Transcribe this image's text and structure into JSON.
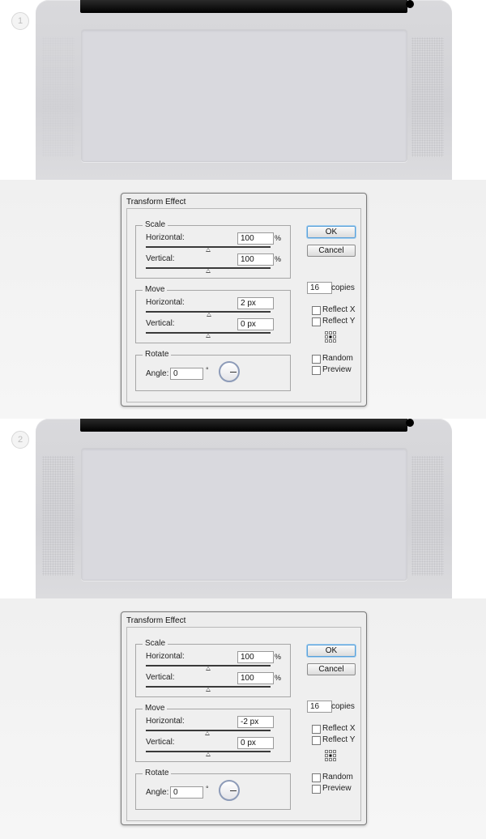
{
  "steps": [
    "1",
    "2"
  ],
  "dialogs": [
    {
      "title": "Transform Effect",
      "scale": {
        "label": "Scale",
        "horizontal_label": "Horizontal:",
        "horizontal_value": "100",
        "horizontal_unit": "%",
        "vertical_label": "Vertical:",
        "vertical_value": "100",
        "vertical_unit": "%"
      },
      "move": {
        "label": "Move",
        "horizontal_label": "Horizontal:",
        "horizontal_value": "2 px",
        "vertical_label": "Vertical:",
        "vertical_value": "0 px"
      },
      "rotate": {
        "label": "Rotate",
        "angle_label": "Angle:",
        "angle_value": "0",
        "degree_symbol": "°"
      },
      "ok_label": "OK",
      "cancel_label": "Cancel",
      "copies_value": "16",
      "copies_label": "copies",
      "reflect_x": "Reflect X",
      "reflect_y": "Reflect Y",
      "random": "Random",
      "preview": "Preview"
    },
    {
      "title": "Transform Effect",
      "scale": {
        "label": "Scale",
        "horizontal_label": "Horizontal:",
        "horizontal_value": "100",
        "horizontal_unit": "%",
        "vertical_label": "Vertical:",
        "vertical_value": "100",
        "vertical_unit": "%"
      },
      "move": {
        "label": "Move",
        "horizontal_label": "Horizontal:",
        "horizontal_value": "-2 px",
        "vertical_label": "Vertical:",
        "vertical_value": "0 px"
      },
      "rotate": {
        "label": "Rotate",
        "angle_label": "Angle:",
        "angle_value": "0",
        "degree_symbol": "°"
      },
      "ok_label": "OK",
      "cancel_label": "Cancel",
      "copies_value": "16",
      "copies_label": "copies",
      "reflect_x": "Reflect X",
      "reflect_y": "Reflect Y",
      "random": "Random",
      "preview": "Preview"
    }
  ]
}
